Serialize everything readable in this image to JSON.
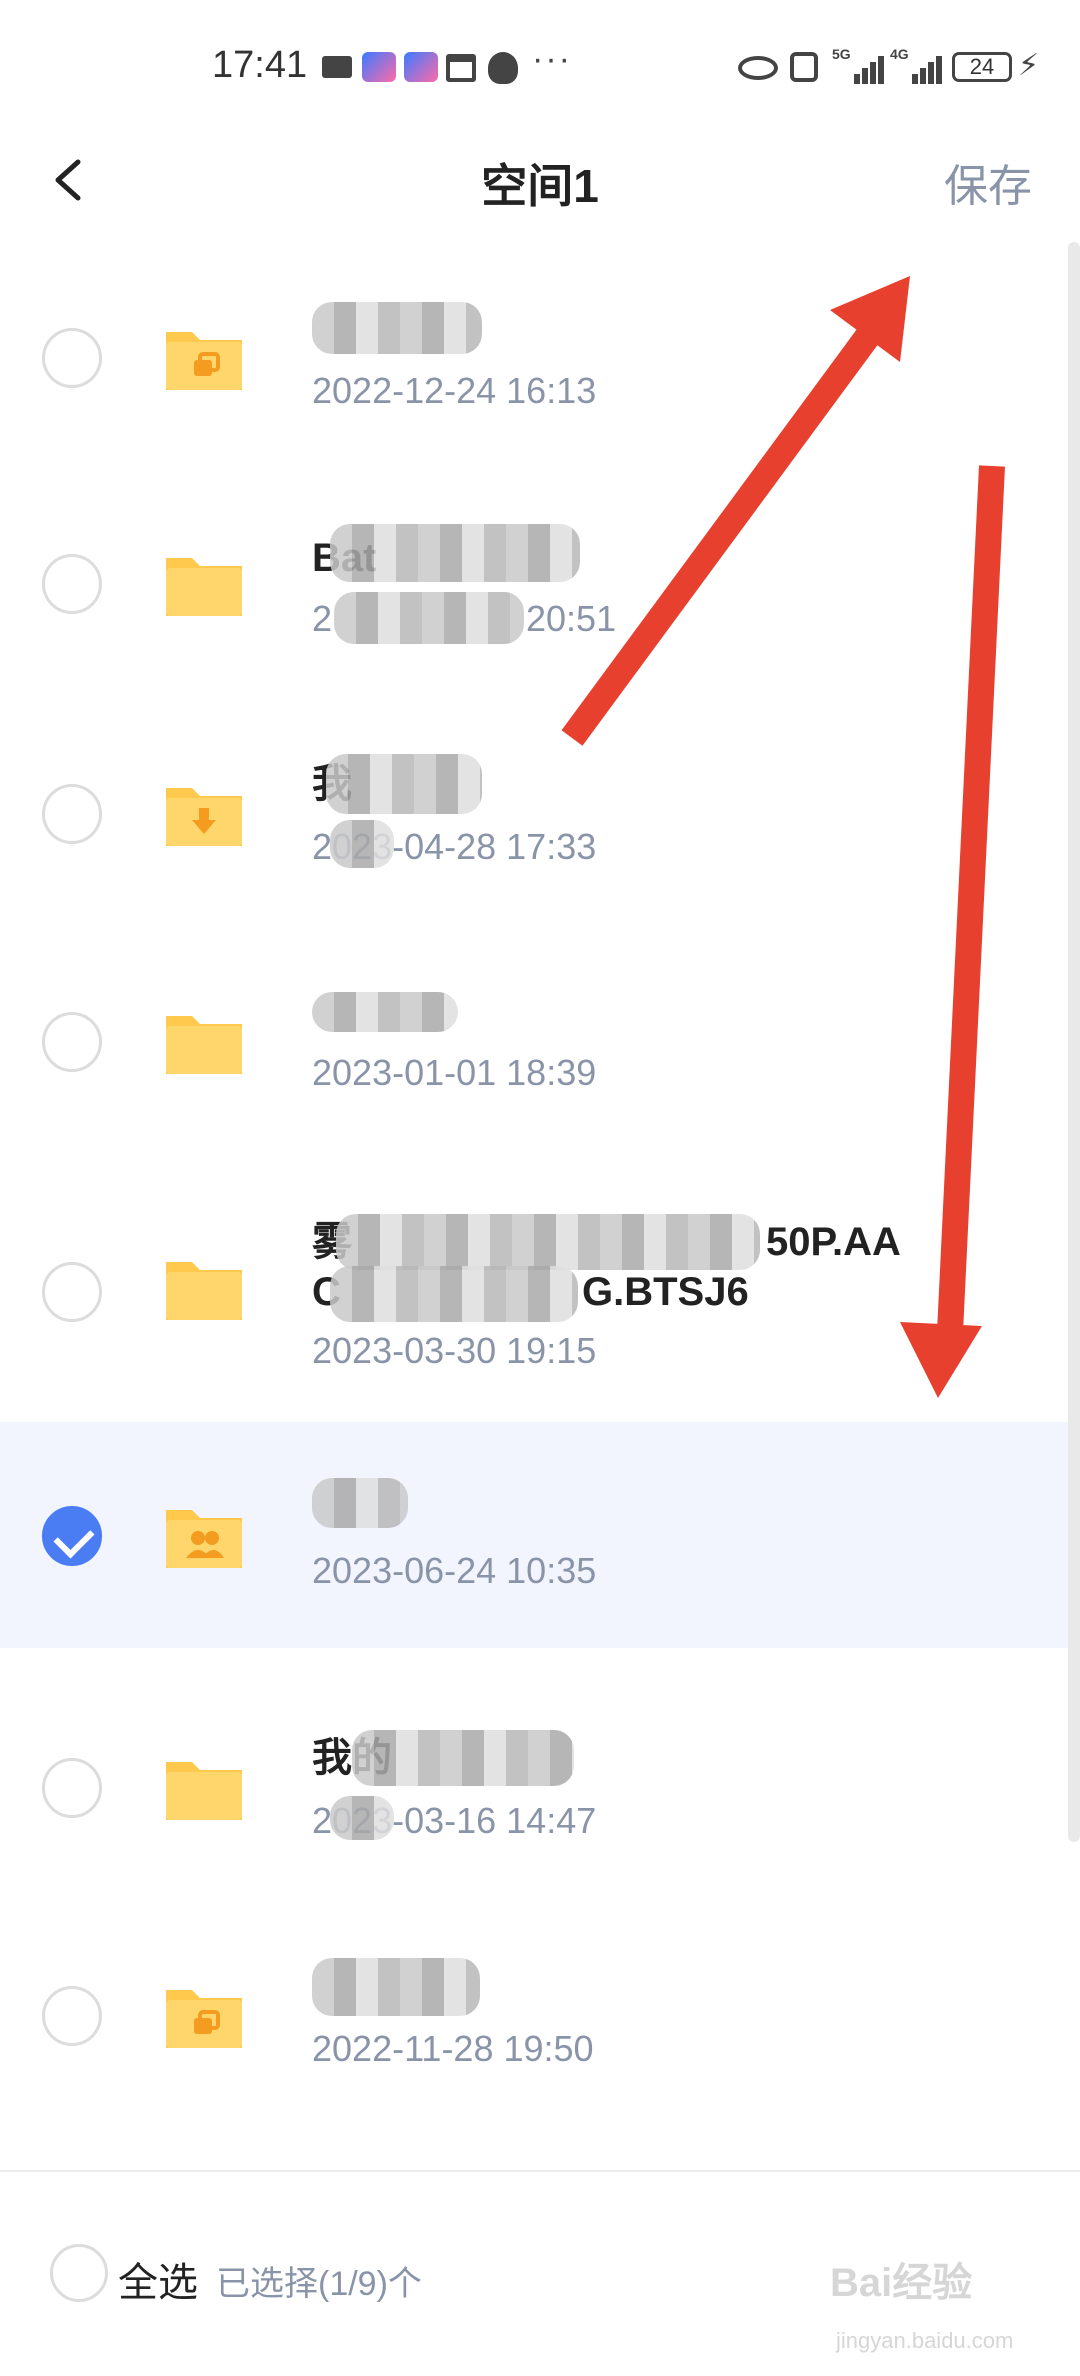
{
  "status_bar": {
    "time": "17:41",
    "network_1": "5G",
    "network_2": "4G",
    "battery": "24",
    "more": "···",
    "icons": [
      "mail-icon",
      "app-icon",
      "app-icon",
      "calendar-icon",
      "qq-icon",
      "eye-icon",
      "nfc-icon",
      "signal-icon",
      "signal-icon",
      "battery-icon",
      "charging-icon"
    ]
  },
  "header": {
    "title": "空间1",
    "save_label": "保存",
    "back_icon": "chevron-left-icon"
  },
  "files": [
    {
      "name": "",
      "date": "2022-12-24 16:13",
      "selected": false,
      "folder_icon": "share-folder-icon"
    },
    {
      "name": "Bat",
      "date": "2",
      "date_suffix": "20:51",
      "selected": false,
      "folder_icon": "folder-icon"
    },
    {
      "name": "我",
      "date": "2023-04-28 17:33",
      "selected": false,
      "folder_icon": "download-folder-icon"
    },
    {
      "name": "",
      "date": "2023-01-01 18:39",
      "selected": false,
      "folder_icon": "folder-icon"
    },
    {
      "name": "雾",
      "name_suffix": "50P.AA",
      "name_line2": "C",
      "name_line2_suffix": "G.BTSJ6",
      "date": "2023-03-30 19:15",
      "selected": false,
      "folder_icon": "folder-icon"
    },
    {
      "name": "",
      "date": "2023-06-24 10:35",
      "selected": true,
      "folder_icon": "shared-users-folder-icon"
    },
    {
      "name": "我的",
      "date": "2023-03-16 14:47",
      "selected": false,
      "folder_icon": "folder-icon"
    },
    {
      "name": "",
      "date": "2022-11-28 19:50",
      "selected": false,
      "folder_icon": "share-folder-icon"
    }
  ],
  "footer": {
    "select_all_label": "全选",
    "selected_count": "已选择(1/9)个"
  },
  "watermark": {
    "text": "Bai经验",
    "sub": "jingyan.baidu.com"
  },
  "colors": {
    "accent": "#4a7cf4",
    "folder": "#ffc94d",
    "selected_row": "#f2f5fe",
    "secondary_text": "#8a94a8",
    "annotation": "#e8402f"
  }
}
